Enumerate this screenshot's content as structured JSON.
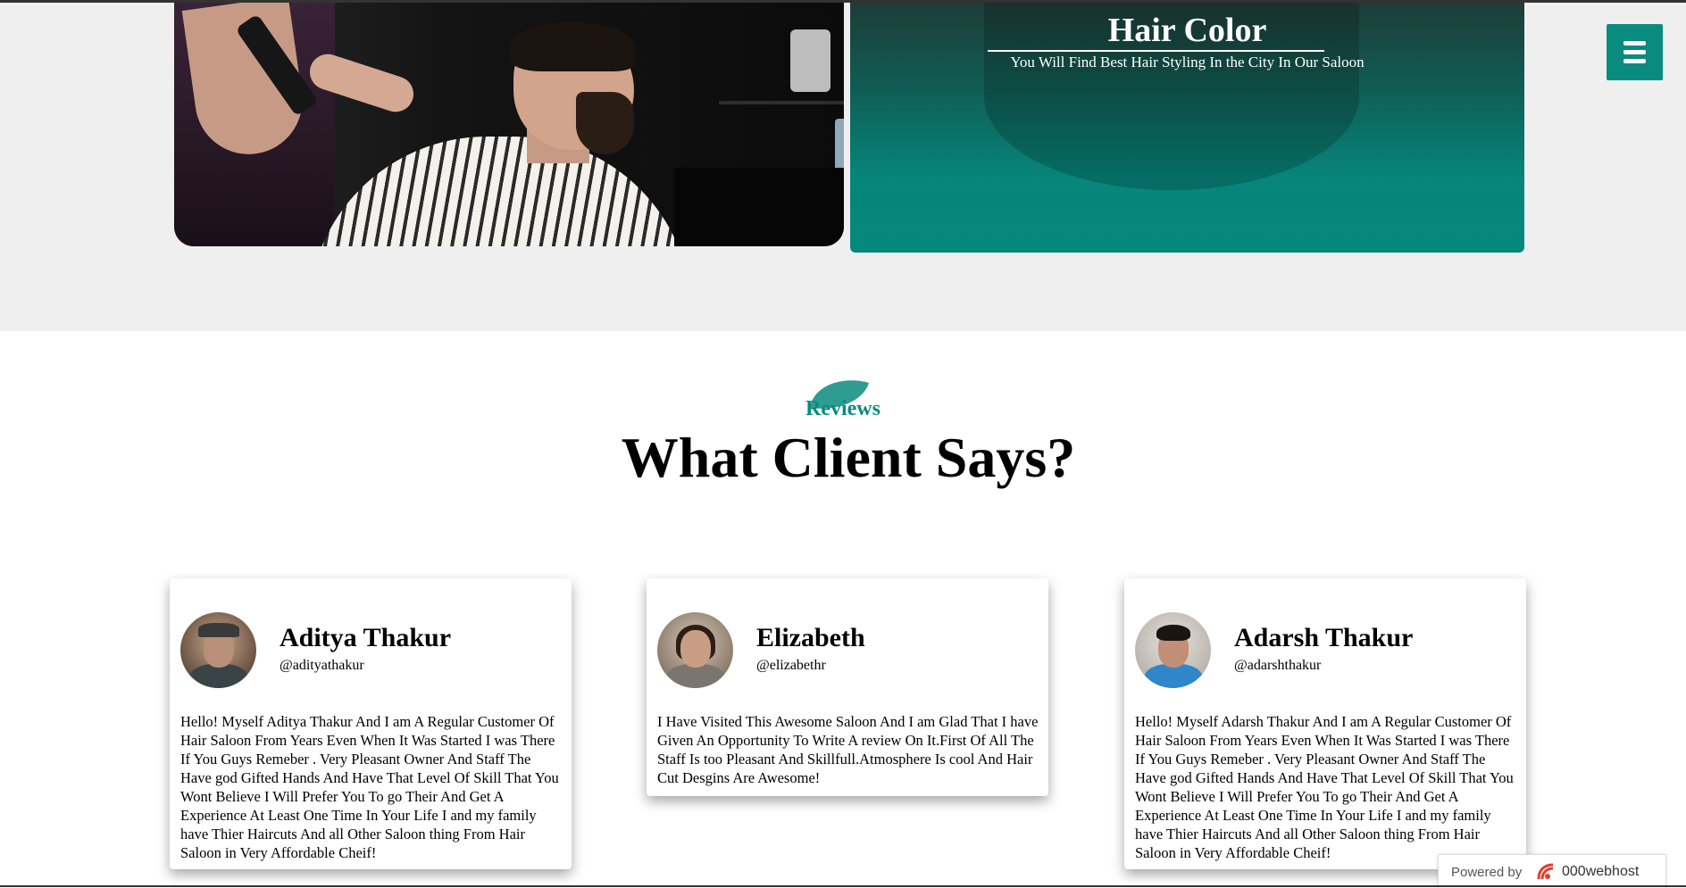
{
  "hero": {
    "card_title": "Hair Color",
    "card_subtitle": "You Will Find Best Hair Styling In the City In Our Saloon"
  },
  "menu": {
    "icon": "hamburger-menu-icon"
  },
  "reviews": {
    "kicker": "Reviews",
    "title": "What Client Says?",
    "items": [
      {
        "name": "Aditya Thakur",
        "handle": "@adityathakur",
        "text": "Hello! Myself Aditya Thakur And I am A Regular Customer Of Hair Saloon From Years Even When It Was Started I was There If You Guys Remeber . Very Pleasant Owner And Staff The Have god Gifted Hands And Have That Level Of Skill That You Wont Believe I Will Prefer You To go Their And Get A Experience At Least One Time In Your Life I and my family have Thier Haircuts And all Other Saloon thing From Hair Saloon in Very Affordable Cheif!"
      },
      {
        "name": "Elizabeth",
        "handle": "@elizabethr",
        "text": "I Have Visited This Awesome Saloon And I am Glad That I have Given An Opportunity To Write A review On It.First Of All The Staff Is too Pleasant And Skillfull.Atmosphere Is cool And Hair Cut Desgins Are Awesome!"
      },
      {
        "name": "Adarsh Thakur",
        "handle": "@adarshthakur",
        "text": "Hello! Myself Adarsh Thakur And I am A Regular Customer Of Hair Saloon From Years Even When It Was Started I was There If You Guys Remeber . Very Pleasant Owner And Staff The Have god Gifted Hands And Have That Level Of Skill That You Wont Believe I Will Prefer You To go Their And Get A Experience At Least One Time In Your Life I and my family have Thier Haircuts And all Other Saloon thing From Hair Saloon in Very Affordable Cheif!"
      }
    ]
  },
  "badge": {
    "powered_label": "Powered by",
    "brand": "000webhost"
  },
  "colors": {
    "accent_teal": "#0a8b7f",
    "hero_background": "#efefef",
    "text": "#000000"
  }
}
